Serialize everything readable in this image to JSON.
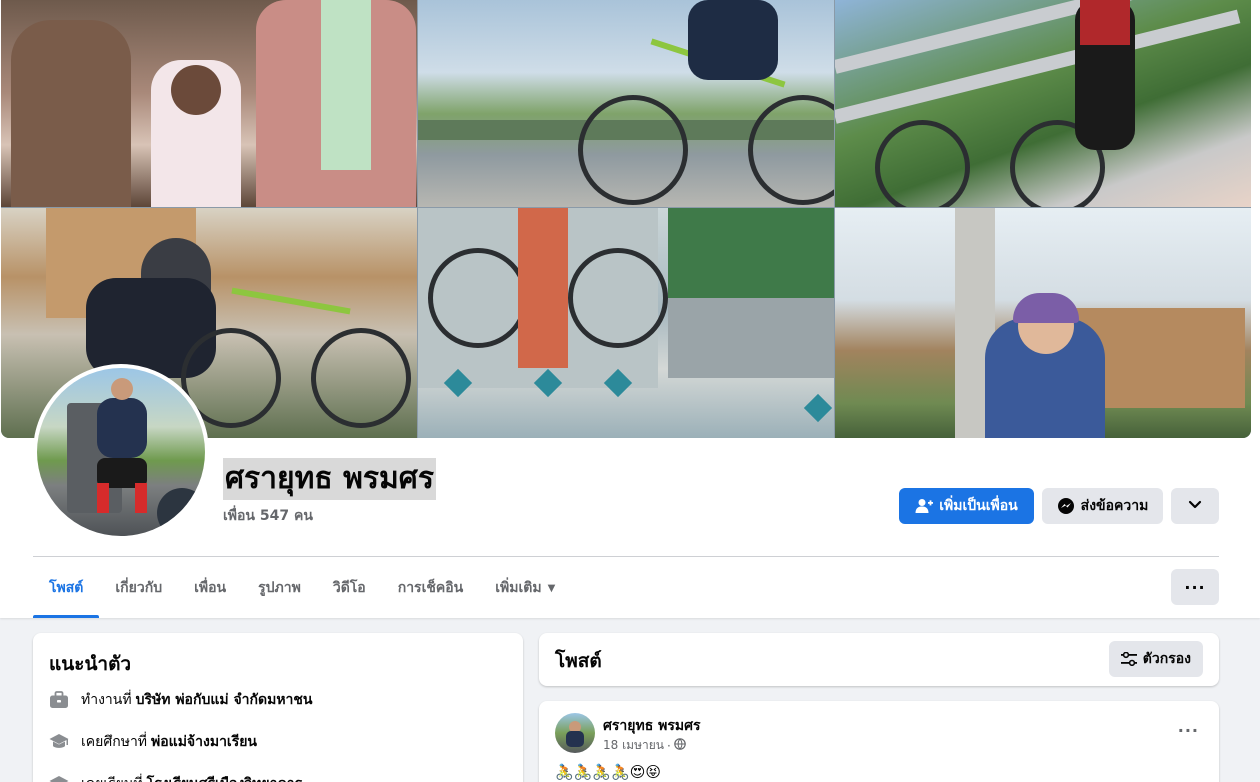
{
  "profile": {
    "name": "ศรายุทธ พรมศร",
    "friend_count": "เพื่อน 547 คน"
  },
  "actions": {
    "add_friend": "เพิ่มเป็นเพื่อน",
    "message": "ส่งข้อความ"
  },
  "tabs": [
    {
      "label": "โพสต์"
    },
    {
      "label": "เกี่ยวกับ"
    },
    {
      "label": "เพื่อน"
    },
    {
      "label": "รูปภาพ"
    },
    {
      "label": "วิดีโอ"
    },
    {
      "label": "การเช็คอิน"
    },
    {
      "label": "เพิ่มเติม"
    }
  ],
  "more_menu": "···",
  "intro": {
    "title": "แนะนำตัว",
    "work_prefix": "ทำงานที่",
    "work_value": "บริษัท พ่อกับแม่ จำกัดมหาชน",
    "edu_prefix": "เคยศึกษาที่",
    "edu_value": "พ่อแม่จ้างมาเรียน",
    "edu2_prefix": "เคยเรียนที่",
    "edu2_value": "โรงเรียนศรีเมืองวิทยาคาร"
  },
  "posts": {
    "title": "โพสต์",
    "filter_label": "ตัวกรอง"
  },
  "post": {
    "author": "ศรายุทธ พรมศร",
    "date": "18 เมษายน",
    "separator": "·",
    "menu": "···",
    "text": "🚴🚴🚴🚴😍😝"
  },
  "colors": {
    "primary": "#1b74e4",
    "background": "#f0f2f5",
    "secondary_button": "#e4e6eb",
    "muted_text": "#65676b"
  }
}
